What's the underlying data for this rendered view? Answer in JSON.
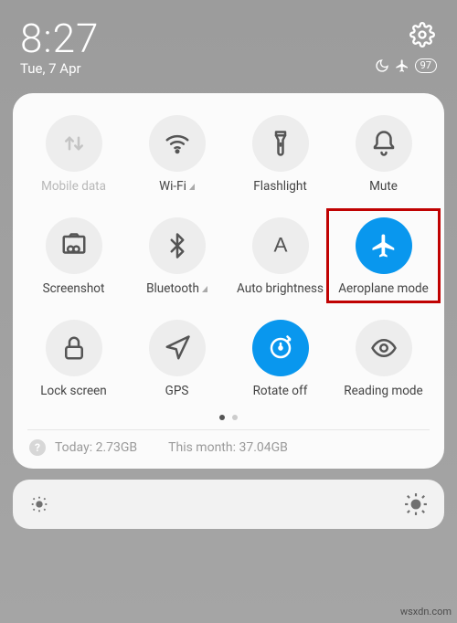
{
  "status": {
    "time": "8:27",
    "date": "Tue, 7 Apr",
    "battery": "97"
  },
  "tiles": [
    {
      "name": "mobile-data",
      "label": "Mobile data",
      "active": false,
      "disabled": true
    },
    {
      "name": "wifi",
      "label": "Wi-Fi",
      "active": false,
      "small_tri": true
    },
    {
      "name": "flashlight",
      "label": "Flashlight",
      "active": false
    },
    {
      "name": "mute",
      "label": "Mute",
      "active": false
    },
    {
      "name": "screenshot",
      "label": "Screenshot",
      "active": false
    },
    {
      "name": "bluetooth",
      "label": "Bluetooth",
      "active": false,
      "small_tri": true
    },
    {
      "name": "auto-brightness",
      "label": "Auto brightness",
      "active": false
    },
    {
      "name": "aeroplane-mode",
      "label": "Aeroplane mode",
      "active": true,
      "highlighted": true
    },
    {
      "name": "lock-screen",
      "label": "Lock screen",
      "active": false
    },
    {
      "name": "gps",
      "label": "GPS",
      "active": false
    },
    {
      "name": "rotate-off",
      "label": "Rotate off",
      "active": true
    },
    {
      "name": "reading-mode",
      "label": "Reading mode",
      "active": false
    }
  ],
  "pager": {
    "pages": 2,
    "active": 0
  },
  "data_usage": {
    "today_label": "Today:",
    "today_value": "2.73GB",
    "month_label": "This month:",
    "month_value": "37.04GB"
  },
  "watermark": "wsxdn.com"
}
